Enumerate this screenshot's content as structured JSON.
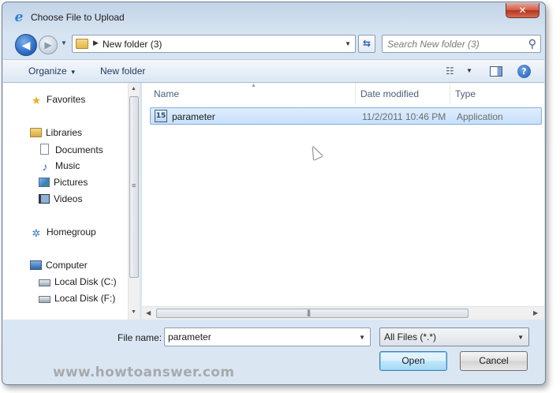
{
  "window": {
    "title": "Choose File to Upload",
    "close_glyph": "✕"
  },
  "nav": {
    "address_path": "New folder (3)",
    "search_placeholder": "Search New folder (3)"
  },
  "toolbar": {
    "organize_label": "Organize",
    "new_folder_label": "New folder"
  },
  "sidebar": {
    "items": [
      {
        "label": "Favorites",
        "icon": "star-icon"
      },
      {
        "label": "Libraries",
        "icon": "libraries-icon"
      },
      {
        "label": "Documents",
        "icon": "documents-icon"
      },
      {
        "label": "Music",
        "icon": "music-icon"
      },
      {
        "label": "Pictures",
        "icon": "pictures-icon"
      },
      {
        "label": "Videos",
        "icon": "videos-icon"
      },
      {
        "label": "Homegroup",
        "icon": "homegroup-icon"
      },
      {
        "label": "Computer",
        "icon": "computer-icon"
      },
      {
        "label": "Local Disk (C:)",
        "icon": "disk-icon"
      },
      {
        "label": "Local Disk (F:)",
        "icon": "disk-icon"
      }
    ]
  },
  "filelist": {
    "columns": [
      "Name",
      "Date modified",
      "Type"
    ],
    "rows": [
      {
        "name": "parameter",
        "date_modified": "11/2/2011 10:46 PM",
        "type": "Application",
        "selected": true
      }
    ]
  },
  "footer": {
    "file_name_label": "File name:",
    "file_name_value": "parameter",
    "file_type_value": "All Files (*.*)",
    "open_label": "Open",
    "cancel_label": "Cancel"
  },
  "watermark": "www.howtoanswer.com",
  "colors": {
    "selection": "#cce4fb",
    "accent": "#2c6cc7",
    "close_button": "#c7432d"
  }
}
